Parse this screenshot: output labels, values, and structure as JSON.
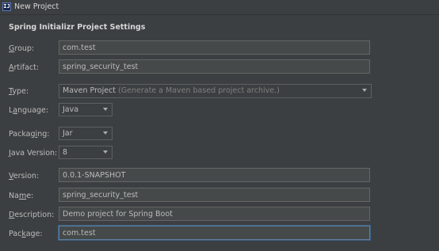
{
  "window": {
    "icon_letter": "IJ",
    "title": "New Project"
  },
  "section": {
    "title": "Spring Initializr Project Settings"
  },
  "fields": {
    "group": {
      "mnemonic": "G",
      "label_rest": "roup:",
      "value": "com.test"
    },
    "artifact": {
      "mnemonic": "A",
      "label_rest": "rtifact:",
      "value": "spring_security_test"
    },
    "type": {
      "mnemonic": "T",
      "label_rest": "ype:",
      "value": "Maven Project",
      "hint": "(Generate a Maven based project archive.)"
    },
    "language": {
      "label_pre": "L",
      "mnemonic": "a",
      "label_rest": "nguage:",
      "value": "Java"
    },
    "packaging": {
      "label_pre": "Packag",
      "mnemonic": "i",
      "label_rest": "ng:",
      "value": "Jar"
    },
    "java_version": {
      "mnemonic": "J",
      "label_rest": "ava Version:",
      "value": "8"
    },
    "version": {
      "mnemonic": "V",
      "label_rest": "ersion:",
      "value": "0.0.1-SNAPSHOT"
    },
    "name": {
      "label_pre": "Na",
      "mnemonic": "m",
      "label_rest": "e:",
      "value": "spring_security_test"
    },
    "description": {
      "mnemonic": "D",
      "label_rest": "escription:",
      "value": "Demo project for Spring Boot"
    },
    "package": {
      "label_pre": "Pac",
      "mnemonic": "k",
      "label_rest": "age:",
      "value": "com.test"
    }
  },
  "colors": {
    "background": "#3c3f41",
    "field_background": "#45494a",
    "focus_border": "#5f7e9e",
    "text": "#bbbbbb"
  }
}
